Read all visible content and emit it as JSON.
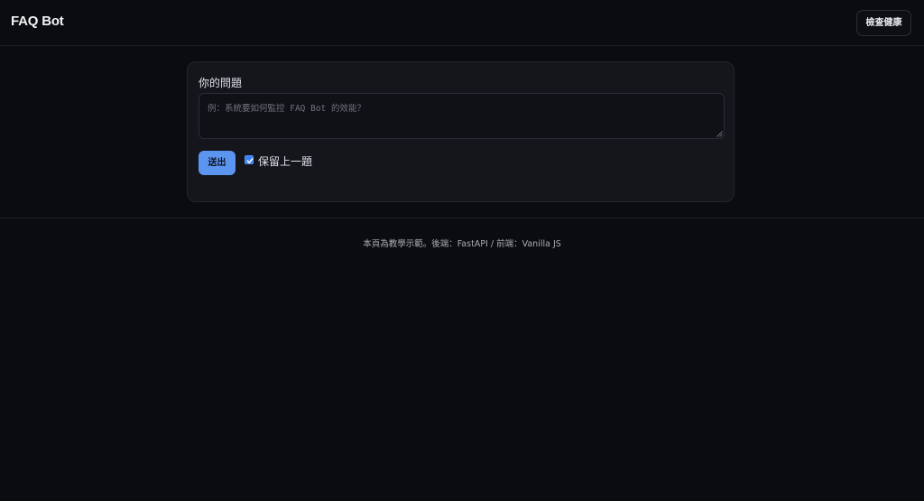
{
  "header": {
    "brand": "FAQ Bot",
    "health_button": "檢查健康"
  },
  "form": {
    "question_label": "你的問題",
    "question_placeholder": "例：系統要如何監控 FAQ Bot 的效能？",
    "question_value": "",
    "send_label": "送出",
    "keep_previous_label": "保留上一題",
    "keep_previous_checked": true
  },
  "footer": {
    "text": "本頁為教學示範。後端：FastAPI / 前端：Vanilla JS"
  },
  "colors": {
    "background": "#0b0c0f",
    "card": "#14161c",
    "accent": "#5b95f0"
  }
}
